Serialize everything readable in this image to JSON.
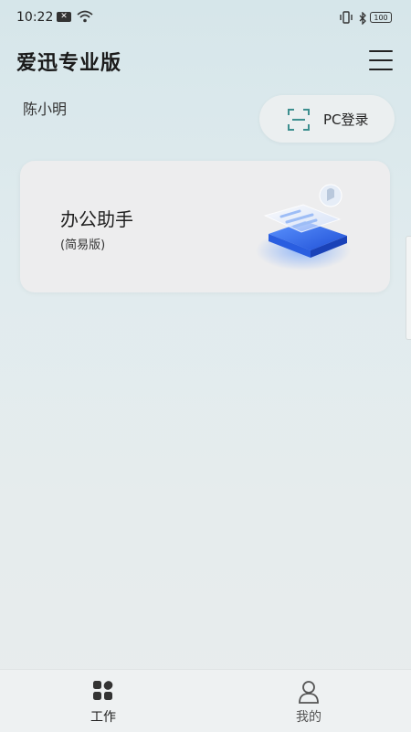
{
  "status_bar": {
    "time": "10:22",
    "battery": "100",
    "icons": [
      "notification-icon",
      "wifi-icon",
      "vibrate-icon",
      "bluetooth-icon",
      "battery-icon"
    ]
  },
  "header": {
    "title": "爱迅专业版",
    "menu_icon": "hamburger-menu-icon"
  },
  "user": {
    "name": "陈小明"
  },
  "pc_login": {
    "label": "PC登录",
    "icon": "scan-icon"
  },
  "card": {
    "title": "办公助手",
    "subtitle": "(简易版)",
    "icon": "document-stack-illustration"
  },
  "bottom_nav": {
    "items": [
      {
        "label": "工作",
        "icon": "apps-grid-icon",
        "active": true
      },
      {
        "label": "我的",
        "icon": "person-icon",
        "active": false
      }
    ]
  },
  "colors": {
    "accent": "#2f6fe6",
    "scan_icon": "#3d8f8f"
  }
}
